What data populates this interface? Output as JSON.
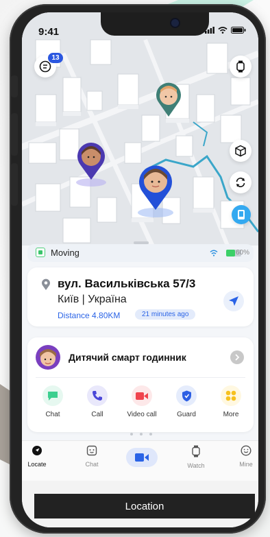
{
  "status_bar": {
    "time": "9:41"
  },
  "map": {
    "notification_count": "13"
  },
  "location_status": {
    "state": "Moving",
    "battery": "60%"
  },
  "address": {
    "street": "вул. Васильківська 57/3",
    "city": "Київ | Україна",
    "distance": "Distance 4.80KM",
    "time_ago": "21 minutes ago"
  },
  "device": {
    "name": "Дитячий смарт годинник"
  },
  "actions": [
    {
      "label": "Chat",
      "icon": "chat-bubble-icon",
      "color": "#3ccf8f"
    },
    {
      "label": "Call",
      "icon": "phone-icon",
      "color": "#4a47d8"
    },
    {
      "label": "Video call",
      "icon": "video-icon",
      "color": "#f0444e"
    },
    {
      "label": "Guard",
      "icon": "shield-icon",
      "color": "#2d5fe4"
    },
    {
      "label": "More",
      "icon": "grid-icon",
      "color": "#f6c11e"
    }
  ],
  "tabs": [
    {
      "label": "Locate",
      "icon": "locate-icon"
    },
    {
      "label": "Chat",
      "icon": "chat-face-icon"
    },
    {
      "label": "",
      "icon": "video-camera-icon"
    },
    {
      "label": "Watch",
      "icon": "watch-icon"
    },
    {
      "label": "Mine",
      "icon": "smile-icon"
    }
  ],
  "footer_button": "Location",
  "colors": {
    "accent": "#2a63e6",
    "moving_green": "#3cc46c",
    "dark": "#222222"
  }
}
